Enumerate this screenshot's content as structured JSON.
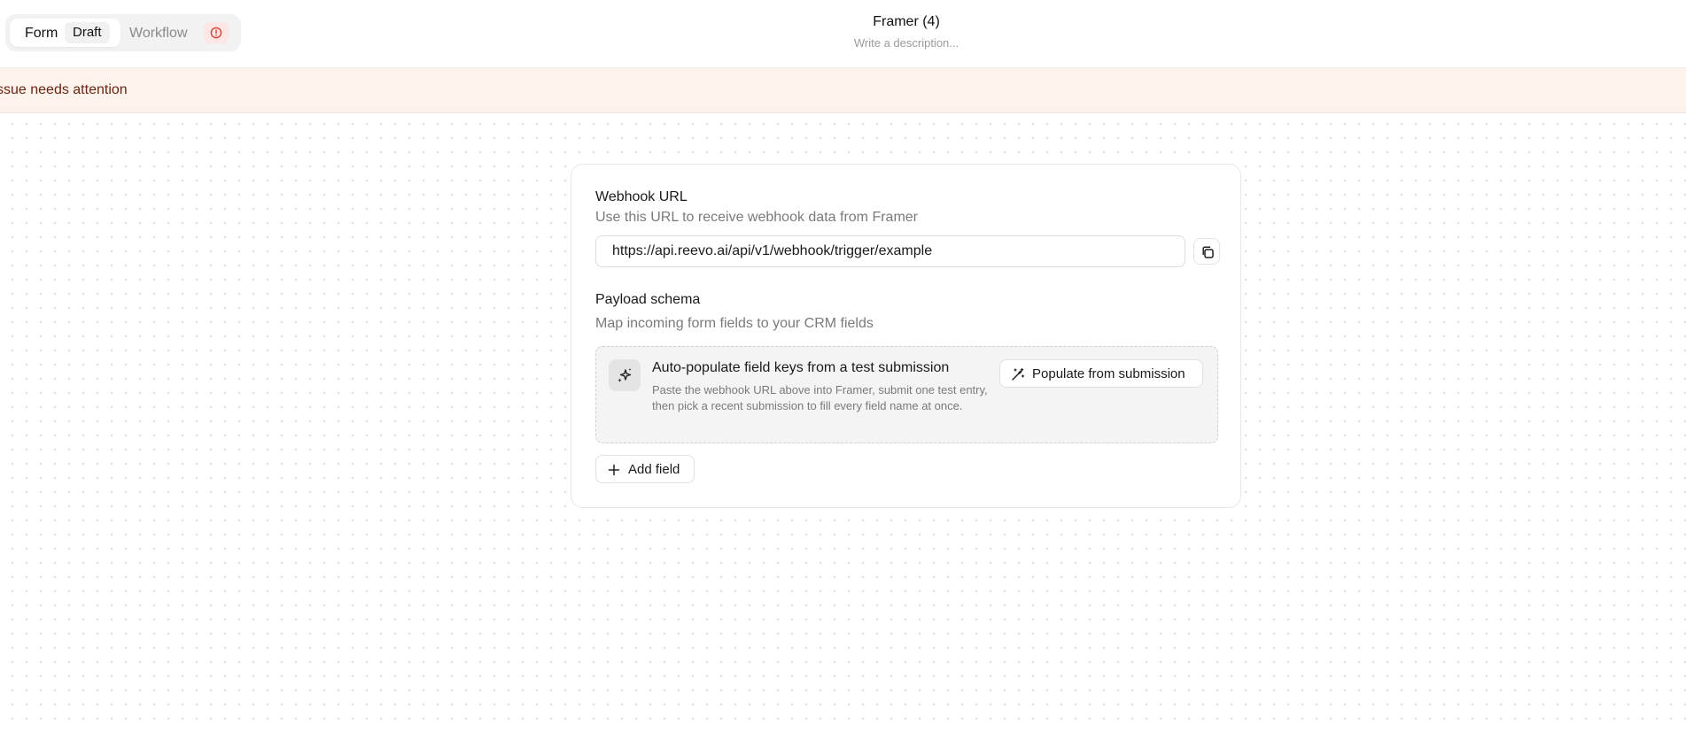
{
  "header": {
    "tabs": {
      "form_label": "Form",
      "draft_badge": "Draft",
      "workflow_label": "Workflow"
    },
    "title": "Framer (4)",
    "description_placeholder": "Write a description..."
  },
  "banner": {
    "text": "ssue needs attention"
  },
  "webhook": {
    "title": "Webhook URL",
    "subtitle": "Use this URL to receive webhook data from Framer",
    "url": "https://api.reevo.ai/api/v1/webhook/trigger/example"
  },
  "payload": {
    "title": "Payload schema",
    "subtitle": "Map incoming form fields to your CRM fields",
    "autopopulate": {
      "title": "Auto-populate field keys from a test submission",
      "description": "Paste the webhook URL above into Framer, submit one test entry, then pick a recent submission to fill every field name at once.",
      "button_label": "Populate from submission"
    },
    "add_field_label": "Add field"
  },
  "icons": {
    "workflow_alert": "alert-circle-icon",
    "copy": "copy-icon",
    "sparkle": "sparkles-icon",
    "populate": "magic-wand-icon",
    "add": "plus-icon"
  },
  "colors": {
    "banner_bg": "#fdf3ec",
    "banner_text": "#6a2412",
    "alert_red": "#d9423a"
  }
}
